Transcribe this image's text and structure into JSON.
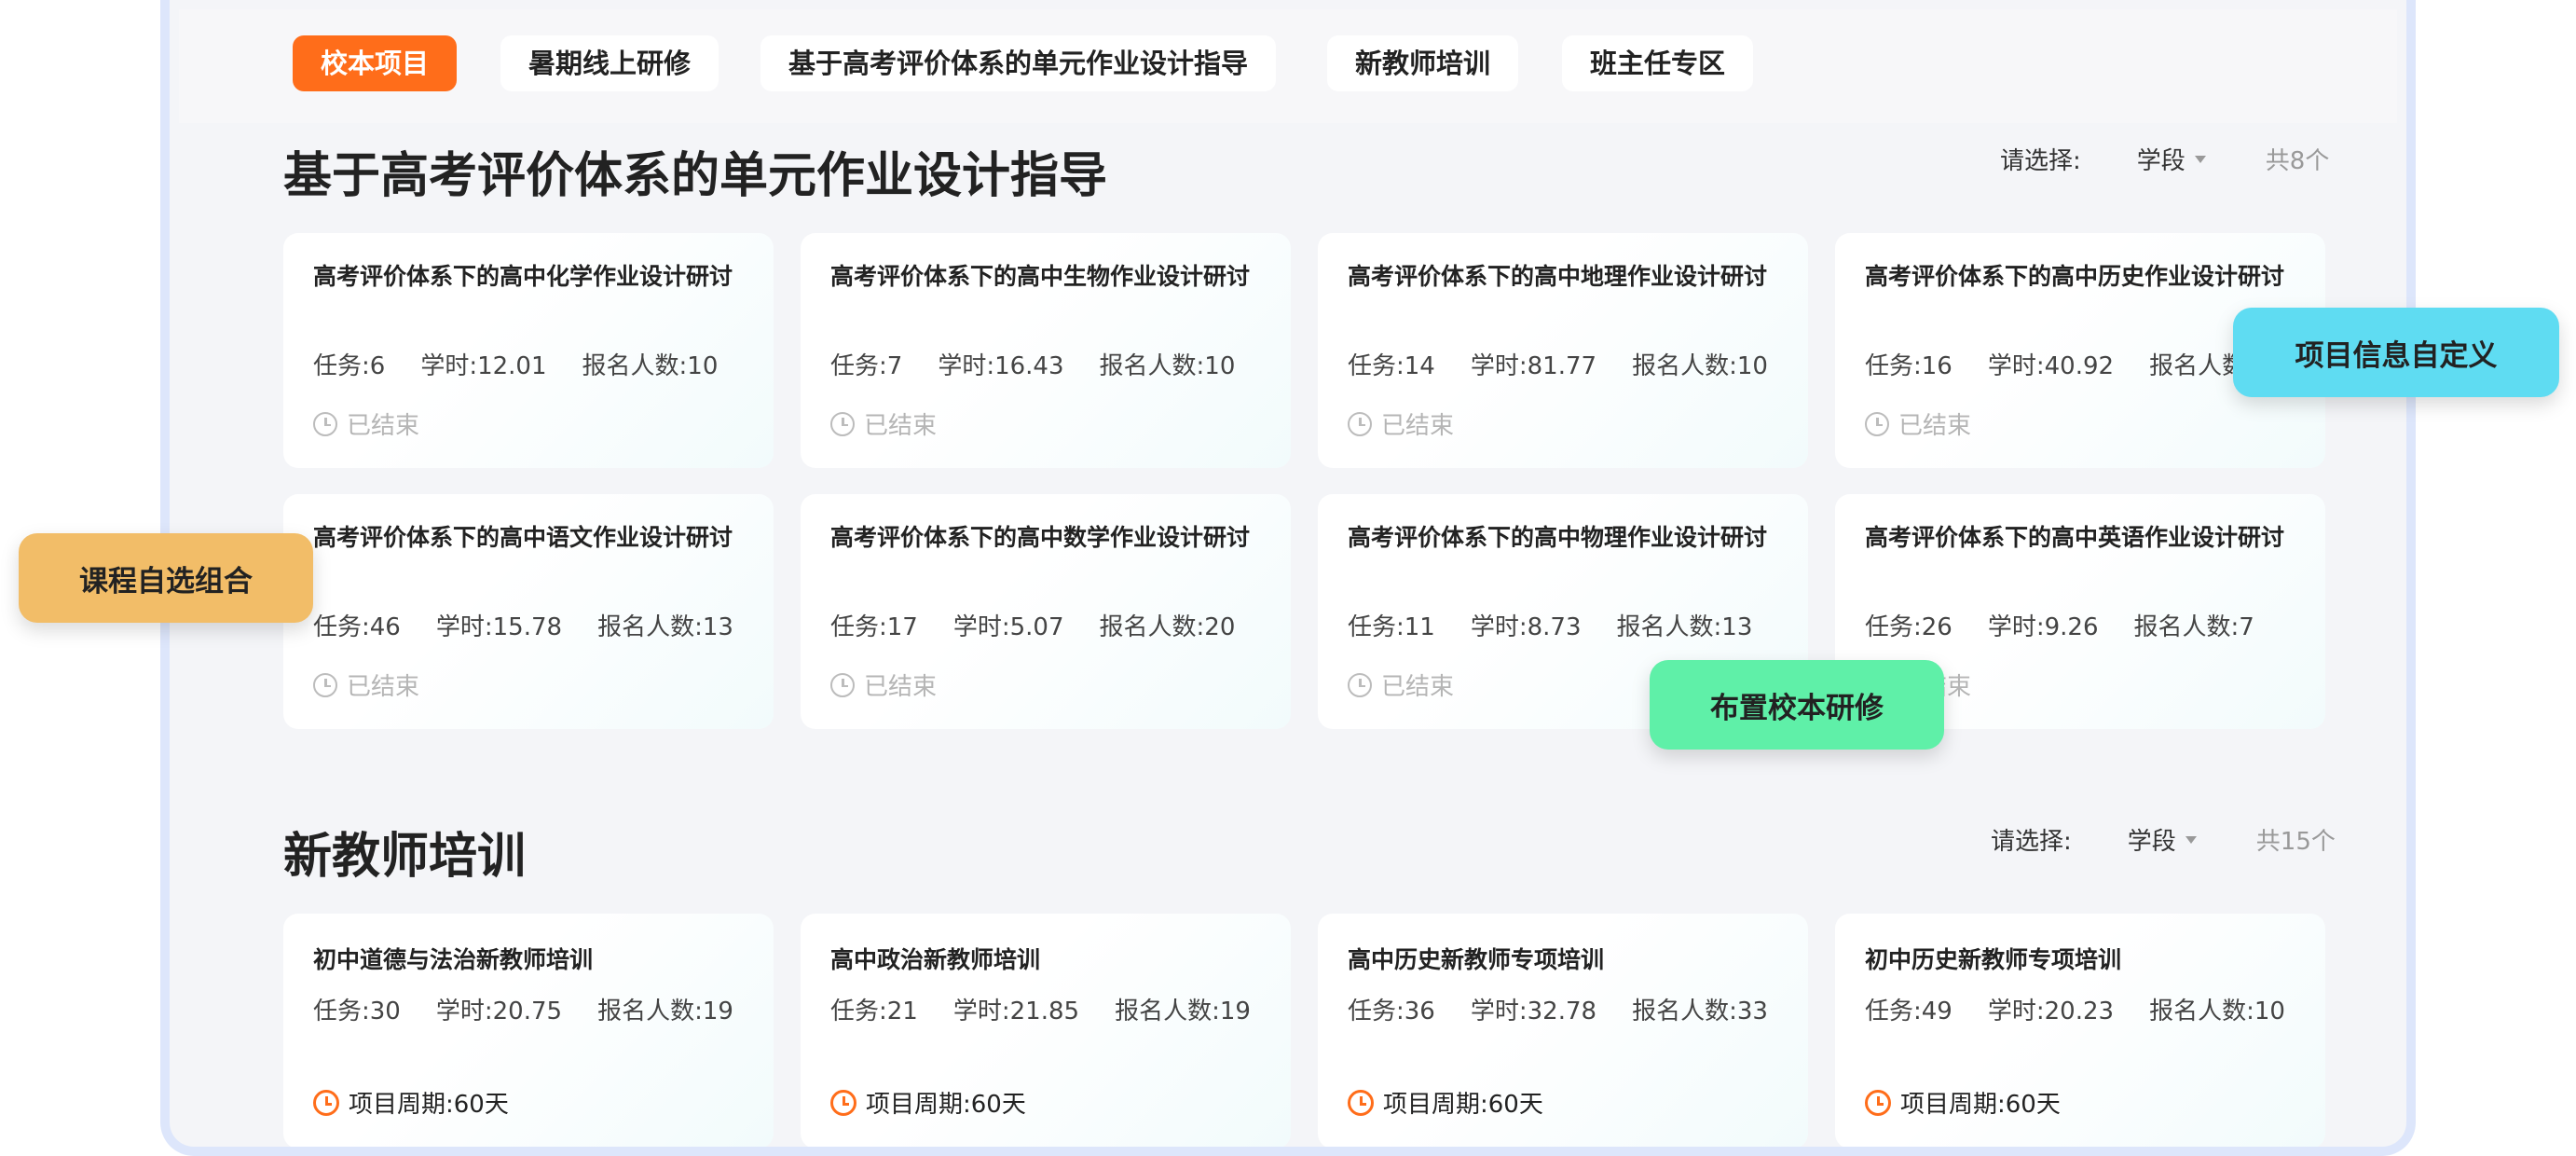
{
  "tabs": [
    {
      "label": "校本项目",
      "active": true
    },
    {
      "label": "暑期线上研修",
      "active": false
    },
    {
      "label": "基于高考评价体系的单元作业设计指导",
      "active": false
    },
    {
      "label": "新教师培训",
      "active": false
    },
    {
      "label": "班主任专区",
      "active": false
    }
  ],
  "section1": {
    "title": "基于高考评价体系的单元作业设计指导",
    "filter_label": "请选择:",
    "filter_value": "学段",
    "count": "共8个",
    "cards": [
      {
        "title": "高考评价体系下的高中化学作业设计研讨",
        "tasks": "任务:6",
        "hours": "学时:12.01",
        "enrolled": "报名人数:10",
        "status": "已结束"
      },
      {
        "title": "高考评价体系下的高中生物作业设计研讨",
        "tasks": "任务:7",
        "hours": "学时:16.43",
        "enrolled": "报名人数:10",
        "status": "已结束"
      },
      {
        "title": "高考评价体系下的高中地理作业设计研讨",
        "tasks": "任务:14",
        "hours": "学时:81.77",
        "enrolled": "报名人数:10",
        "status": "已结束"
      },
      {
        "title": "高考评价体系下的高中历史作业设计研讨",
        "tasks": "任务:16",
        "hours": "学时:40.92",
        "enrolled": "报名人数:10",
        "status": "已结束"
      },
      {
        "title": "高考评价体系下的高中语文作业设计研讨",
        "tasks": "任务:46",
        "hours": "学时:15.78",
        "enrolled": "报名人数:13",
        "status": "已结束"
      },
      {
        "title": "高考评价体系下的高中数学作业设计研讨",
        "tasks": "任务:17",
        "hours": "学时:5.07",
        "enrolled": "报名人数:20",
        "status": "已结束"
      },
      {
        "title": "高考评价体系下的高中物理作业设计研讨",
        "tasks": "任务:11",
        "hours": "学时:8.73",
        "enrolled": "报名人数:13",
        "status": "已结束"
      },
      {
        "title": "高考评价体系下的高中英语作业设计研讨",
        "tasks": "任务:26",
        "hours": "学时:9.26",
        "enrolled": "报名人数:7",
        "status": "已结束"
      }
    ]
  },
  "section2": {
    "title": "新教师培训",
    "filter_label": "请选择:",
    "filter_value": "学段",
    "count": "共15个",
    "cards": [
      {
        "title": "初中道德与法治新教师培训",
        "tasks": "任务:30",
        "hours": "学时:20.75",
        "enrolled": "报名人数:19",
        "period": "项目周期:60天"
      },
      {
        "title": "高中政治新教师培训",
        "tasks": "任务:21",
        "hours": "学时:21.85",
        "enrolled": "报名人数:19",
        "period": "项目周期:60天"
      },
      {
        "title": "高中历史新教师专项培训",
        "tasks": "任务:36",
        "hours": "学时:32.78",
        "enrolled": "报名人数:33",
        "period": "项目周期:60天"
      },
      {
        "title": "初中历史新教师专项培训",
        "tasks": "任务:49",
        "hours": "学时:20.23",
        "enrolled": "报名人数:10",
        "period": "项目周期:60天"
      }
    ]
  },
  "badges": {
    "custom_info": "项目信息自定义",
    "course_combo": "课程自选组合",
    "assign_research": "布置校本研修"
  },
  "colors": {
    "accent": "#ff6d1a",
    "badge_blue": "#5fdcf2",
    "badge_orange": "#f2bd68",
    "badge_green": "#5ff0a8"
  }
}
